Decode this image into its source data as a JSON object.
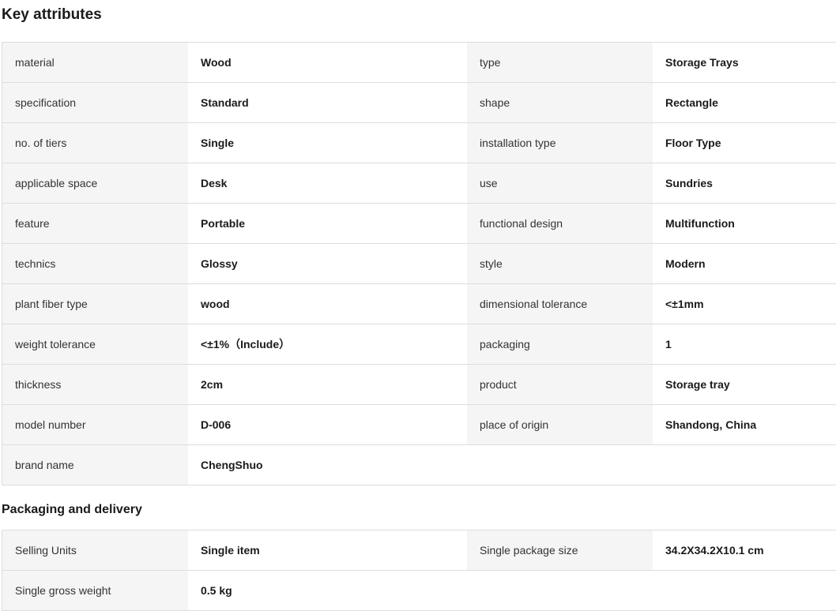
{
  "key_attributes": {
    "title": "Key attributes",
    "rows": [
      {
        "label1": "material",
        "value1": "Wood",
        "label2": "type",
        "value2": "Storage Trays"
      },
      {
        "label1": "specification",
        "value1": "Standard",
        "label2": "shape",
        "value2": "Rectangle"
      },
      {
        "label1": "no. of tiers",
        "value1": "Single",
        "label2": "installation type",
        "value2": "Floor Type"
      },
      {
        "label1": "applicable space",
        "value1": "Desk",
        "label2": "use",
        "value2": "Sundries"
      },
      {
        "label1": "feature",
        "value1": "Portable",
        "label2": "functional design",
        "value2": "Multifunction"
      },
      {
        "label1": "technics",
        "value1": "Glossy",
        "label2": "style",
        "value2": "Modern"
      },
      {
        "label1": "plant fiber type",
        "value1": "wood",
        "label2": "dimensional tolerance",
        "value2": "<±1mm"
      },
      {
        "label1": "weight tolerance",
        "value1": "<±1%（Include）",
        "label2": "packaging",
        "value2": "1"
      },
      {
        "label1": "thickness",
        "value1": "2cm",
        "label2": "product",
        "value2": "Storage tray"
      },
      {
        "label1": "model number",
        "value1": "D-006",
        "label2": "place of origin",
        "value2": "Shandong, China"
      },
      {
        "label1": "brand name",
        "value1": "ChengShuo",
        "label2": "",
        "value2": ""
      }
    ]
  },
  "packaging_delivery": {
    "title": "Packaging and delivery",
    "rows": [
      {
        "label1": "Selling Units",
        "value1": "Single item",
        "label2": "Single package size",
        "value2": "34.2X34.2X10.1 cm"
      },
      {
        "label1": "Single gross weight",
        "value1": "0.5 kg",
        "label2": "",
        "value2": ""
      }
    ]
  },
  "colors": {
    "label_bg": "#f5f5f5",
    "border": "#dddddd",
    "text": "#1a1a1a"
  }
}
